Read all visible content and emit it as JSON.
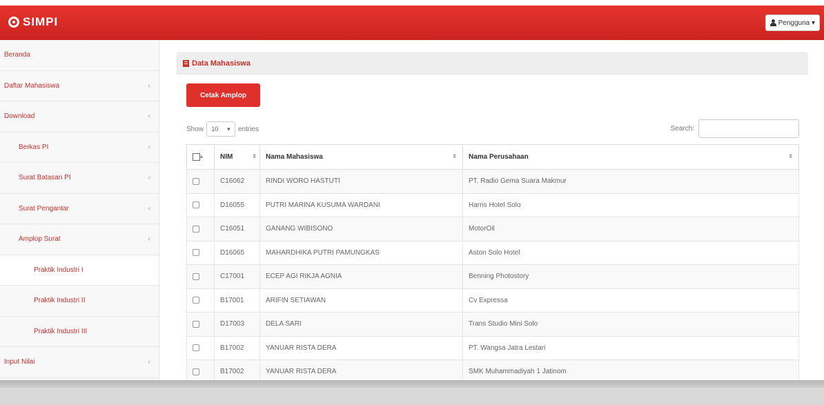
{
  "app": {
    "brand": "SIMPI",
    "user_menu": "Pengguna ▾"
  },
  "sidebar": {
    "items": [
      {
        "label": "Beranda",
        "chevron": ""
      },
      {
        "label": "Daftar Mahasiswa",
        "chevron": "‹"
      },
      {
        "label": "Download",
        "chevron": "‹"
      },
      {
        "label": "Berkas PI",
        "chevron": "‹"
      },
      {
        "label": "Surat Batasan PI",
        "chevron": "‹"
      },
      {
        "label": "Surat Pengantar",
        "chevron": "‹"
      },
      {
        "label": "Amplop Surat",
        "chevron": "‹"
      },
      {
        "label": "Praktik Industri I",
        "chevron": ""
      },
      {
        "label": "Praktik Industri II",
        "chevron": ""
      },
      {
        "label": "Praktik Industri III",
        "chevron": ""
      },
      {
        "label": "Input Nilai",
        "chevron": "‹"
      }
    ]
  },
  "panel": {
    "title": "Data Mahasiswa",
    "cetak_label": "Cetak Amplop"
  },
  "table_controls": {
    "show_label": "Show",
    "entries_value": "10",
    "entries_label": "entries",
    "search_label": "Search:"
  },
  "table": {
    "headers": [
      "NIM",
      "Nama Mahasiswa",
      "Nama Perusahaan"
    ],
    "rows": [
      {
        "nim": "C16062",
        "nama": "RINDI WORO HASTUTI",
        "perusahaan": "PT. Radio Gema Suara Makmur"
      },
      {
        "nim": "D16055",
        "nama": "PUTRI MARINA KUSUMA WARDANI",
        "perusahaan": "Harris Hotel Solo"
      },
      {
        "nim": "C16051",
        "nama": "GANANG WIBISONO",
        "perusahaan": "MotorOil"
      },
      {
        "nim": "D16065",
        "nama": "MAHARDHIKA PUTRI PAMUNGKAS",
        "perusahaan": "Aston Solo Hotel"
      },
      {
        "nim": "C17001",
        "nama": "ECEP AGI RIKJA AGNIA",
        "perusahaan": "Benning Photostory"
      },
      {
        "nim": "B17001",
        "nama": "ARIFIN SETIAWAN",
        "perusahaan": "Cv Expressa"
      },
      {
        "nim": "D17003",
        "nama": "DELA SARI",
        "perusahaan": "Trans Studio Mini Solo"
      },
      {
        "nim": "B17002",
        "nama": "YANUAR RISTA DERA",
        "perusahaan": "PT. Wangsa Jatra Lestari"
      },
      {
        "nim": "B17002",
        "nama": "YANUAR RISTA DERA",
        "perusahaan": "SMK Muhammadiyah 1 Jatinom"
      }
    ]
  },
  "colors": {
    "brand_red": "#e0302b",
    "link_red": "#c9302c"
  }
}
